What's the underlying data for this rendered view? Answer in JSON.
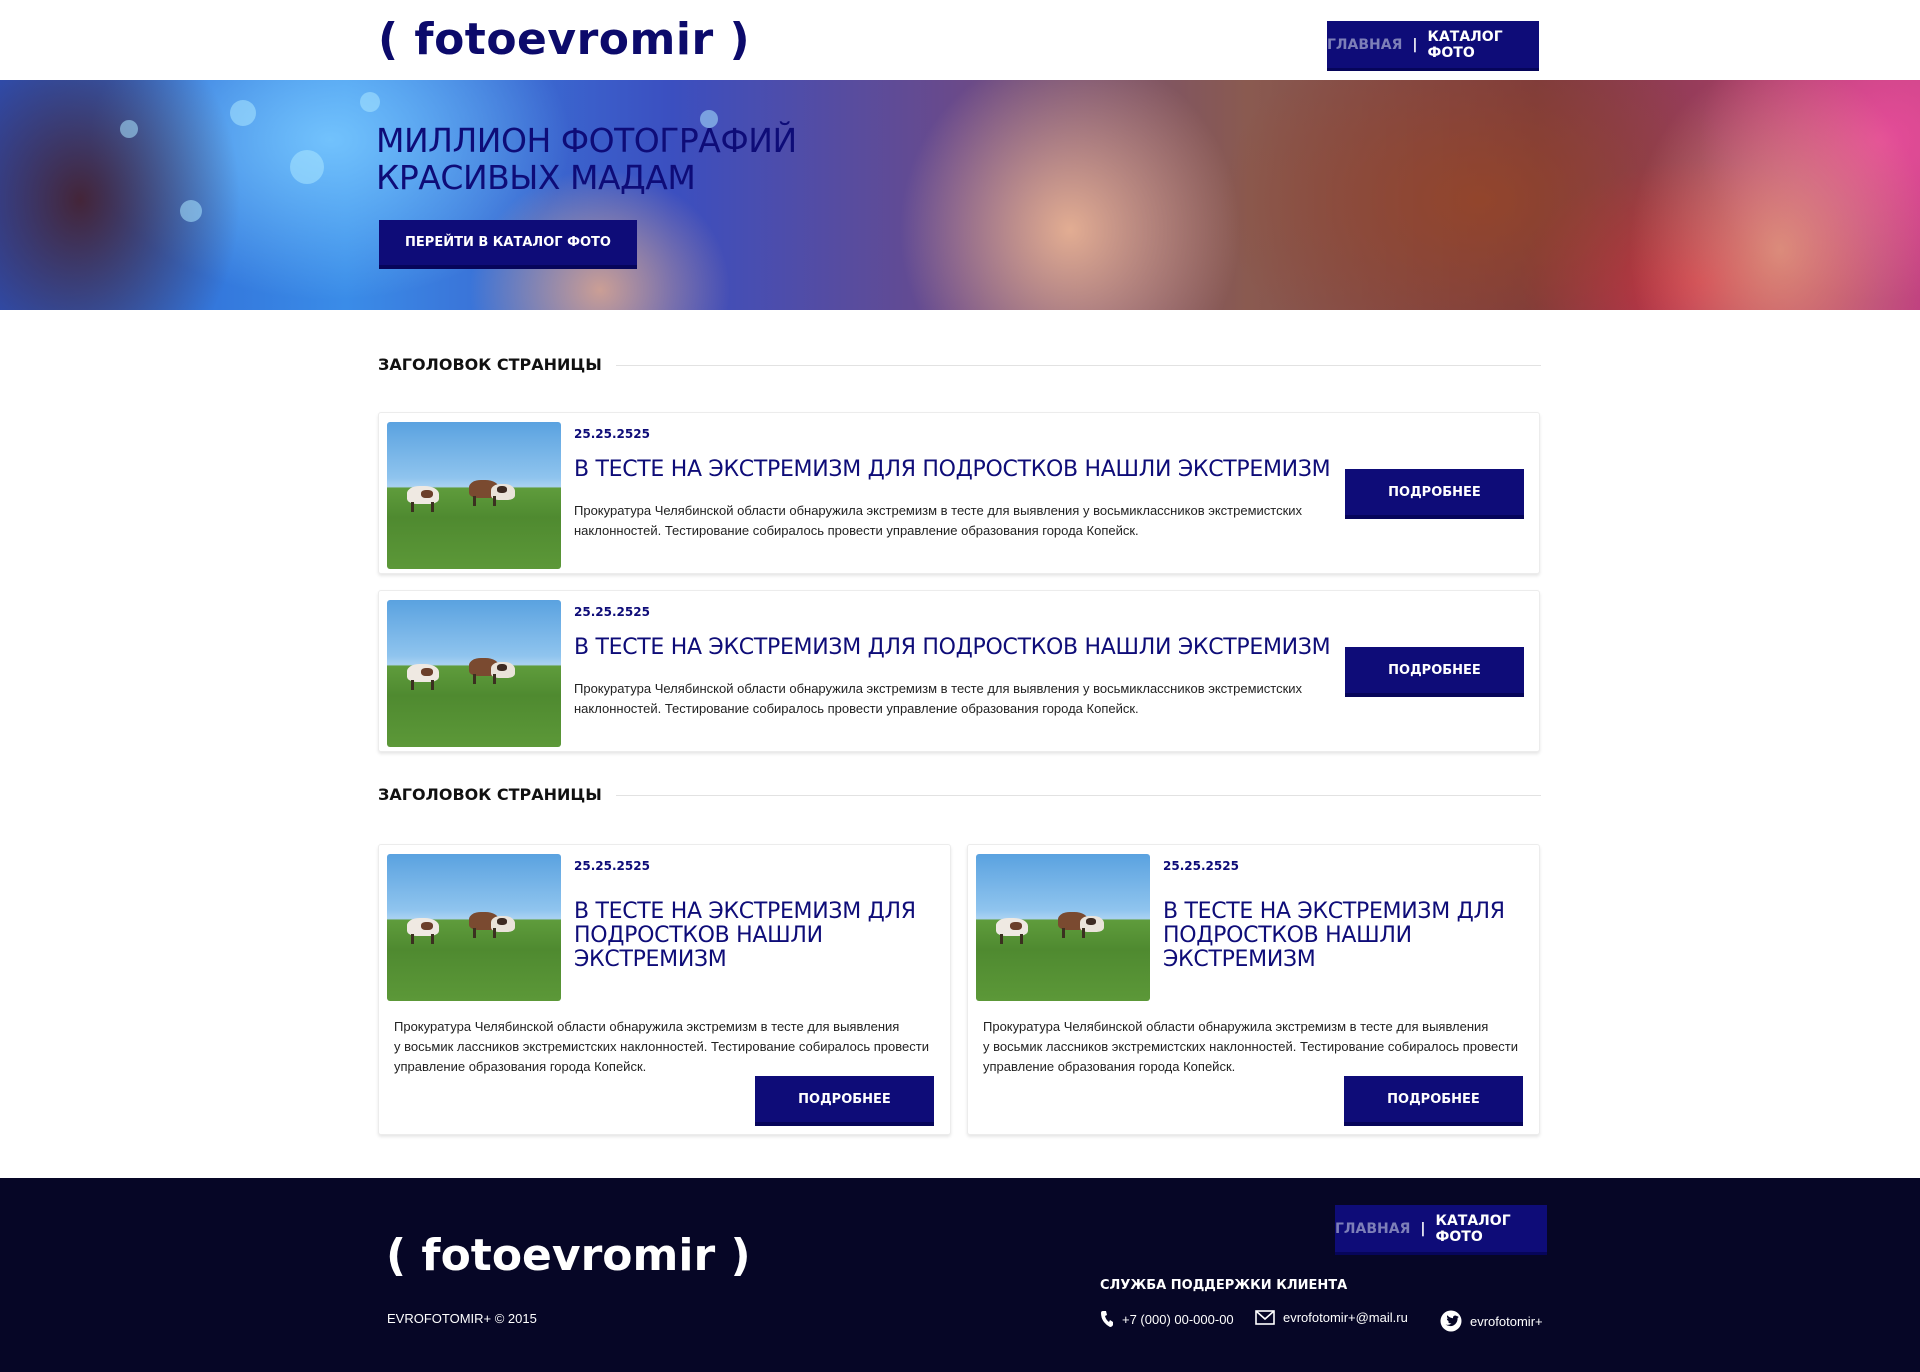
{
  "header": {
    "logo": "( fotoevromir )",
    "nav": {
      "home": "ГЛАВНАЯ",
      "separator": "|",
      "catalog": "КАТАЛОГ ФОТО"
    }
  },
  "hero": {
    "title_line1": "МИЛЛИОН ФОТОГРАФИЙ",
    "title_line2": "КРАСИВЫХ МАДАМ",
    "button": "ПЕРЕЙТИ В КАТАЛОГ ФОТО"
  },
  "sections": [
    {
      "title": "ЗАГОЛОВОК СТРАНИЦЫ"
    },
    {
      "title": "ЗАГОЛОВОК СТРАНИЦЫ"
    }
  ],
  "wide_cards": [
    {
      "date": "25.25.2525",
      "title": "В ТЕСТЕ НА ЭКСТРЕМИЗМ ДЛЯ ПОДРОСТКОВ НАШЛИ ЭКСТРЕМИЗМ",
      "desc_line1": "Прокуратура Челябинской области обнаружила экстремизм в тесте для выявления у восьмиклассников экстремистских",
      "desc_line2": "наклонностей. Тестирование собиралось провести управление образования города Копейск.",
      "button": "ПОДРОБНЕЕ"
    },
    {
      "date": "25.25.2525",
      "title": "В ТЕСТЕ НА ЭКСТРЕМИЗМ ДЛЯ ПОДРОСТКОВ НАШЛИ ЭКСТРЕМИЗМ",
      "desc_line1": "Прокуратура Челябинской области обнаружила экстремизм в тесте для выявления у восьмиклассников экстремистских",
      "desc_line2": "наклонностей. Тестирование собиралось провести управление образования города Копейск.",
      "button": "ПОДРОБНЕЕ"
    }
  ],
  "half_cards": [
    {
      "date": "25.25.2525",
      "title_line1": "В ТЕСТЕ НА ЭКСТРЕМИЗМ ДЛЯ",
      "title_line2": "ПОДРОСТКОВ НАШЛИ",
      "title_line3": "ЭКСТРЕМИЗМ",
      "desc_line1": "Прокуратура Челябинской области обнаружила экстремизм в тесте для выявления",
      "desc_line2": "у восьмик лассников экстремистских наклонностей. Тестирование собиралось провести",
      "desc_line3": "управление образования города Копейск.",
      "button": "ПОДРОБНЕЕ"
    },
    {
      "date": "25.25.2525",
      "title_line1": "В ТЕСТЕ НА ЭКСТРЕМИЗМ ДЛЯ",
      "title_line2": "ПОДРОСТКОВ НАШЛИ",
      "title_line3": "ЭКСТРЕМИЗМ",
      "desc_line1": "Прокуратура Челябинской области обнаружила экстремизм в тесте для выявления",
      "desc_line2": "у восьмик лассников экстремистских наклонностей. Тестирование собиралось провести",
      "desc_line3": "управление образования города Копейск.",
      "button": "ПОДРОБНЕЕ"
    }
  ],
  "footer": {
    "logo": "( fotoevromir )",
    "copyright": "EVROFOTOMIR+ © 2015",
    "nav": {
      "home": "ГЛАВНАЯ",
      "separator": "|",
      "catalog": "КАТАЛОГ ФОТО"
    },
    "support_title": "СЛУЖБА ПОДДЕРЖКИ КЛИЕНТА",
    "phone": "+7 (000) 00-000-00",
    "email": "evrofotomir+@mail.ru",
    "twitter": "evrofotomir+"
  },
  "colors": {
    "brand_navy": "#0e0c78",
    "footer_bg": "#060626",
    "nav_inactive": "#7d7fb8"
  },
  "icons": [
    "phone-icon",
    "mail-icon",
    "twitter-icon"
  ]
}
